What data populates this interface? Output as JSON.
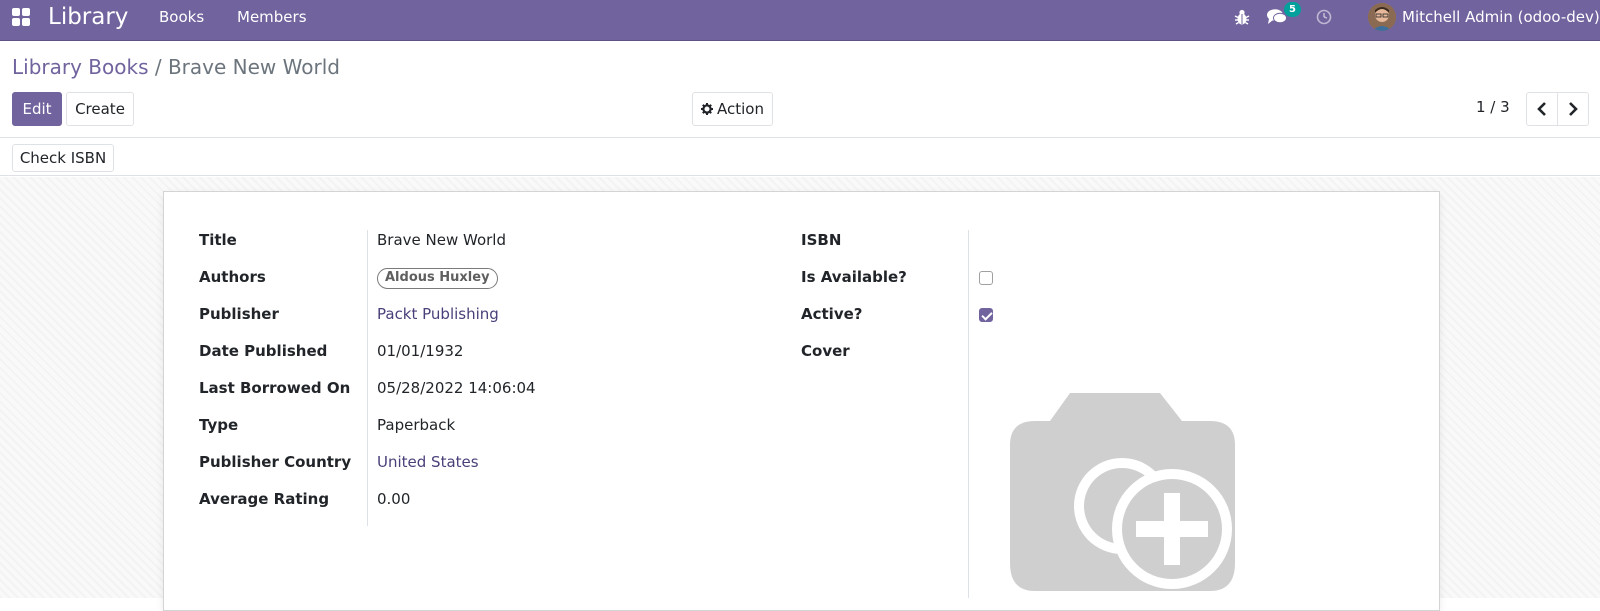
{
  "navbar": {
    "brand": "Library",
    "menu": [
      "Books",
      "Members"
    ],
    "messages_badge": "5",
    "user": "Mitchell Admin (odoo-dev)"
  },
  "breadcrumb": {
    "parent": "Library Books",
    "separator": "/",
    "current": "Brave New World"
  },
  "toolbar": {
    "edit_label": "Edit",
    "create_label": "Create",
    "action_label": "Action",
    "pager": "1 / 3"
  },
  "statusbar": {
    "check_isbn_label": "Check ISBN"
  },
  "form": {
    "left": [
      {
        "label": "Title",
        "value": "Brave New World"
      },
      {
        "label": "Authors",
        "value": "Aldous Huxley"
      },
      {
        "label": "Publisher",
        "value": "Packt Publishing"
      },
      {
        "label": "Date Published",
        "value": "01/01/1932"
      },
      {
        "label": "Last Borrowed On",
        "value": "05/28/2022 14:06:04"
      },
      {
        "label": "Type",
        "value": "Paperback"
      },
      {
        "label": "Publisher Country",
        "value": "United States"
      },
      {
        "label": "Average Rating",
        "value": "0.00"
      }
    ],
    "right": [
      {
        "label": "ISBN",
        "value": ""
      },
      {
        "label": "Is Available?",
        "checked": false
      },
      {
        "label": "Active?",
        "checked": true
      },
      {
        "label": "Cover"
      }
    ]
  },
  "colors": {
    "brand": "#71639e",
    "badge": "#00a09d",
    "link": "#4b3f7a"
  },
  "icons": [
    "apps-grid-icon",
    "bug-icon",
    "chat-icon",
    "clock-icon",
    "gear-icon",
    "chevron-left-icon",
    "chevron-right-icon",
    "camera-plus-icon"
  ]
}
